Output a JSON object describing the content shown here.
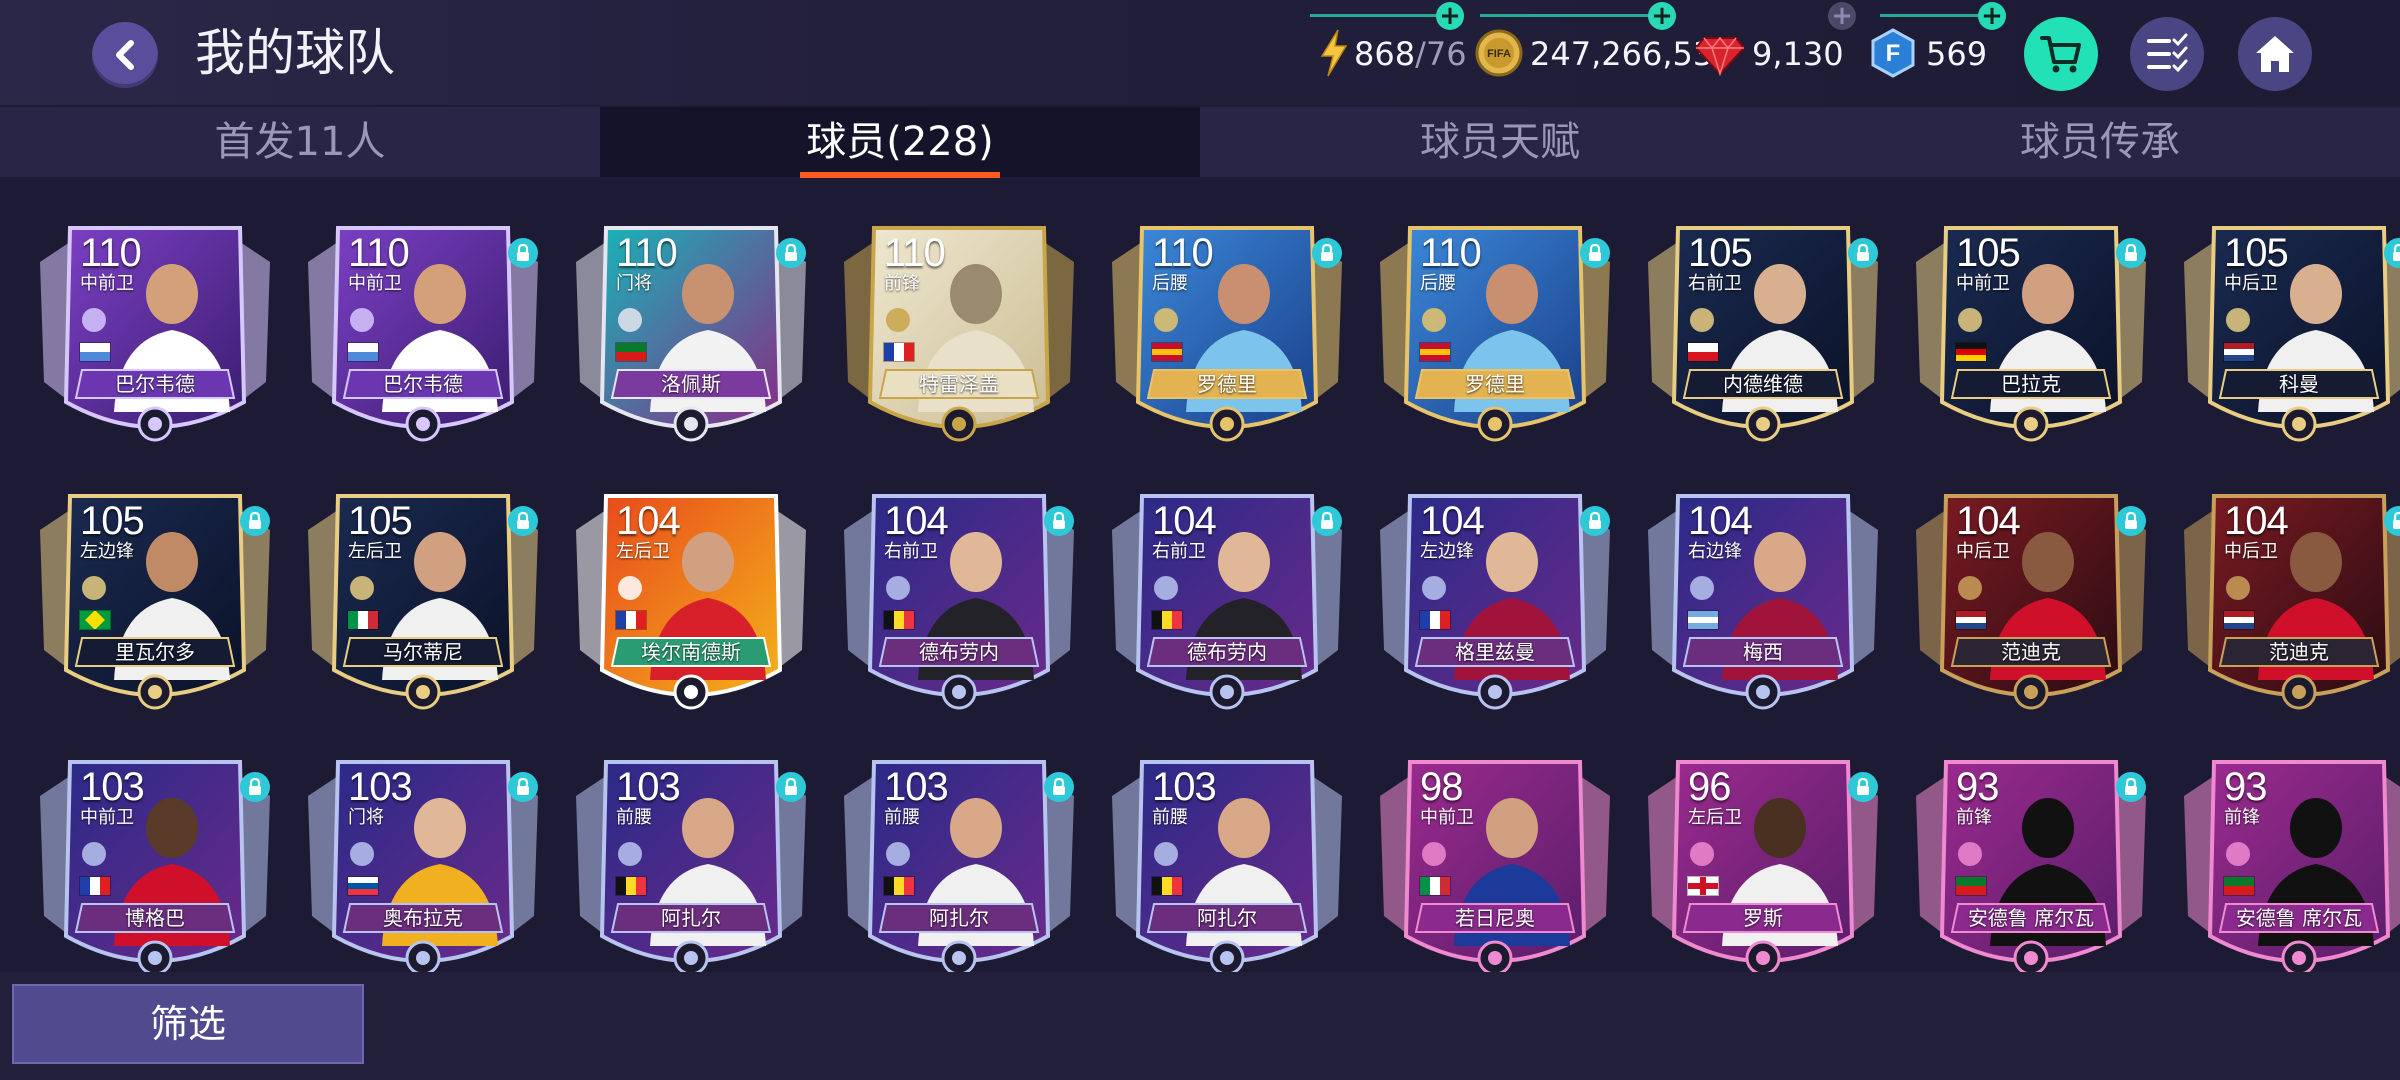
{
  "header": {
    "title": "我的球队",
    "energy": {
      "value": "868",
      "sub": "/76"
    },
    "coins": "247,266,539",
    "gems": "9,130",
    "fifa_points": "569",
    "coin_icon_text": "FIFA",
    "points_icon_text": "F"
  },
  "tabs": [
    {
      "label": "首发11人"
    },
    {
      "label": "球员(228)"
    },
    {
      "label": "球员天赋"
    },
    {
      "label": "球员传承"
    }
  ],
  "cards": [
    {
      "rating": "110",
      "position": "中前卫",
      "name": "巴尔韦德",
      "theme": "purple",
      "locked": false,
      "flag": "uruguay",
      "jersey": "#ffffff",
      "skin": "#d4a07a"
    },
    {
      "rating": "110",
      "position": "中前卫",
      "name": "巴尔韦德",
      "theme": "purple",
      "locked": true,
      "flag": "uruguay",
      "jersey": "#ffffff",
      "skin": "#d4a07a"
    },
    {
      "rating": "110",
      "position": "门将",
      "name": "洛佩斯",
      "theme": "teal",
      "locked": true,
      "flag": "portugal",
      "jersey": "#f2f2f2",
      "skin": "#c89170"
    },
    {
      "rating": "110",
      "position": "前锋",
      "name": "特雷泽盖",
      "theme": "icon",
      "locked": false,
      "flag": "france",
      "jersey": "#e8e0c8",
      "skin": "#9a8a70"
    },
    {
      "rating": "110",
      "position": "后腰",
      "name": "罗德里",
      "theme": "sky",
      "locked": true,
      "flag": "spain",
      "jersey": "#7cc4ec",
      "skin": "#c89070"
    },
    {
      "rating": "110",
      "position": "后腰",
      "name": "罗德里",
      "theme": "sky",
      "locked": true,
      "flag": "spain",
      "jersey": "#7cc4ec",
      "skin": "#c89070"
    },
    {
      "rating": "105",
      "position": "右前卫",
      "name": "内德维德",
      "theme": "gold",
      "locked": true,
      "flag": "czech",
      "jersey": "#f0f0f0",
      "skin": "#d8b090"
    },
    {
      "rating": "105",
      "position": "中前卫",
      "name": "巴拉克",
      "theme": "gold",
      "locked": true,
      "flag": "germany",
      "jersey": "#f0f0f0",
      "skin": "#d0a080"
    },
    {
      "rating": "105",
      "position": "中后卫",
      "name": "科曼",
      "theme": "gold",
      "locked": true,
      "flag": "netherlands",
      "jersey": "#f0f0f0",
      "skin": "#d8b090"
    },
    {
      "rating": "105",
      "position": "左边锋",
      "name": "里瓦尔多",
      "theme": "gold",
      "locked": true,
      "flag": "brazil",
      "jersey": "#f0f0f0",
      "skin": "#c08a66"
    },
    {
      "rating": "105",
      "position": "左后卫",
      "name": "马尔蒂尼",
      "theme": "gold",
      "locked": true,
      "flag": "italy",
      "jersey": "#f0f0f0",
      "skin": "#d0a080"
    },
    {
      "rating": "104",
      "position": "左后卫",
      "name": "埃尔南德斯",
      "theme": "fire",
      "locked": false,
      "flag": "france",
      "jersey": "#d8202a",
      "skin": "#d0a080"
    },
    {
      "rating": "104",
      "position": "右前卫",
      "name": "德布劳内",
      "theme": "galaxy",
      "locked": true,
      "flag": "belgium",
      "jersey": "#222228",
      "skin": "#e0b898"
    },
    {
      "rating": "104",
      "position": "右前卫",
      "name": "德布劳内",
      "theme": "galaxy",
      "locked": true,
      "flag": "belgium",
      "jersey": "#222228",
      "skin": "#e0b898"
    },
    {
      "rating": "104",
      "position": "左边锋",
      "name": "格里兹曼",
      "theme": "galaxy",
      "locked": true,
      "flag": "france",
      "jersey": "#a0143c",
      "skin": "#e0b898"
    },
    {
      "rating": "104",
      "position": "右边锋",
      "name": "梅西",
      "theme": "galaxy",
      "locked": false,
      "flag": "argentina",
      "jersey": "#a0143c",
      "skin": "#d8a888"
    },
    {
      "rating": "104",
      "position": "中后卫",
      "name": "范迪克",
      "theme": "bronze",
      "locked": true,
      "flag": "netherlands",
      "jersey": "#d0102a",
      "skin": "#8a5a40"
    },
    {
      "rating": "104",
      "position": "中后卫",
      "name": "范迪克",
      "theme": "bronze",
      "locked": true,
      "flag": "netherlands",
      "jersey": "#d0102a",
      "skin": "#8a5a40"
    },
    {
      "rating": "103",
      "position": "中前卫",
      "name": "博格巴",
      "theme": "galaxy",
      "locked": true,
      "flag": "france",
      "jersey": "#d0102a",
      "skin": "#5a3a28"
    },
    {
      "rating": "103",
      "position": "门将",
      "name": "奥布拉克",
      "theme": "galaxy",
      "locked": true,
      "flag": "slovenia",
      "jersey": "#f0b020",
      "skin": "#e0b898"
    },
    {
      "rating": "103",
      "position": "前腰",
      "name": "阿扎尔",
      "theme": "galaxy",
      "locked": true,
      "flag": "belgium",
      "jersey": "#f0f0f0",
      "skin": "#d8a888"
    },
    {
      "rating": "103",
      "position": "前腰",
      "name": "阿扎尔",
      "theme": "galaxy",
      "locked": true,
      "flag": "belgium",
      "jersey": "#f0f0f0",
      "skin": "#d8a888"
    },
    {
      "rating": "103",
      "position": "前腰",
      "name": "阿扎尔",
      "theme": "galaxy",
      "locked": false,
      "flag": "belgium",
      "jersey": "#f0f0f0",
      "skin": "#d8a888"
    },
    {
      "rating": "98",
      "position": "中前卫",
      "name": "若日尼奥",
      "theme": "pink",
      "locked": false,
      "flag": "italy",
      "jersey": "#1c3a9a",
      "skin": "#d0a080"
    },
    {
      "rating": "96",
      "position": "左后卫",
      "name": "罗斯",
      "theme": "pink",
      "locked": true,
      "flag": "england",
      "jersey": "#f0f0f0",
      "skin": "#4a3020"
    },
    {
      "rating": "93",
      "position": "前锋",
      "name": "安德鲁 席尔瓦",
      "theme": "pink",
      "locked": true,
      "flag": "portugal",
      "jersey": "#111111",
      "skin": "#111111"
    },
    {
      "rating": "93",
      "position": "前锋",
      "name": "安德鲁 席尔瓦",
      "theme": "pink",
      "locked": false,
      "flag": "portugal",
      "jersey": "#111111",
      "skin": "#111111"
    }
  ],
  "themes": {
    "purple": {
      "bg1": "#7b3fc4",
      "bg2": "#3a1d6e",
      "rim": "#d7c7ff",
      "band": "#6a37b0"
    },
    "teal": {
      "bg1": "#19b3b7",
      "bg2": "#8a2a86",
      "rim": "#e6e6f0",
      "band": "#7b3a9e"
    },
    "icon": {
      "bg1": "#efe7cf",
      "bg2": "#cbbd94",
      "rim": "#c9a54a",
      "band": "#e9dfc2"
    },
    "sky": {
      "bg1": "#3b88d8",
      "bg2": "#1a3f8a",
      "rim": "#e7c46a",
      "band": "#e3b352"
    },
    "gold": {
      "bg1": "#1a2a50",
      "bg2": "#0b1228",
      "rim": "#e8cd82",
      "band": "#141b32"
    },
    "fire": {
      "bg1": "#e84a1c",
      "bg2": "#f4b21a",
      "rim": "#ffffff",
      "band": "#2a9c74"
    },
    "galaxy": {
      "bg1": "#2a2a88",
      "bg2": "#6a2a8a",
      "rim": "#b8c4f0",
      "band": "#6b2d7e"
    },
    "bronze": {
      "bg1": "#7a1a22",
      "bg2": "#2a0c12",
      "rim": "#c9a05a",
      "band": "#2a2433"
    },
    "pink": {
      "bg1": "#9a2a8e",
      "bg2": "#5a1e6a",
      "rim": "#f08ad0",
      "band": "#8a2a8e"
    }
  },
  "flags": {
    "uruguay": [
      "#ffffff",
      "#4d8ad9"
    ],
    "portugal": [
      "#0a7a2a",
      "#d81a1a"
    ],
    "france": [
      "#1f3fa8",
      "#ffffff",
      "#e02020"
    ],
    "spain": [
      "#c8102e",
      "#ffc400",
      "#c8102e"
    ],
    "czech": [
      "#ffffff",
      "#d8141e"
    ],
    "germany": [
      "#111111",
      "#dd0000",
      "#ffce00"
    ],
    "netherlands": [
      "#ae1c28",
      "#ffffff",
      "#21468b"
    ],
    "brazil": [
      "#009b3a",
      "#fedf00"
    ],
    "italy": [
      "#009246",
      "#ffffff",
      "#ce2b37"
    ],
    "belgium": [
      "#111111",
      "#fdda24",
      "#ef3340"
    ],
    "argentina": [
      "#74acdf",
      "#ffffff",
      "#74acdf"
    ],
    "slovenia": [
      "#ffffff",
      "#0055a4",
      "#ef3340"
    ],
    "england": [
      "#ffffff",
      "#ce1124"
    ]
  },
  "footer": {
    "filter_label": "筛选"
  }
}
